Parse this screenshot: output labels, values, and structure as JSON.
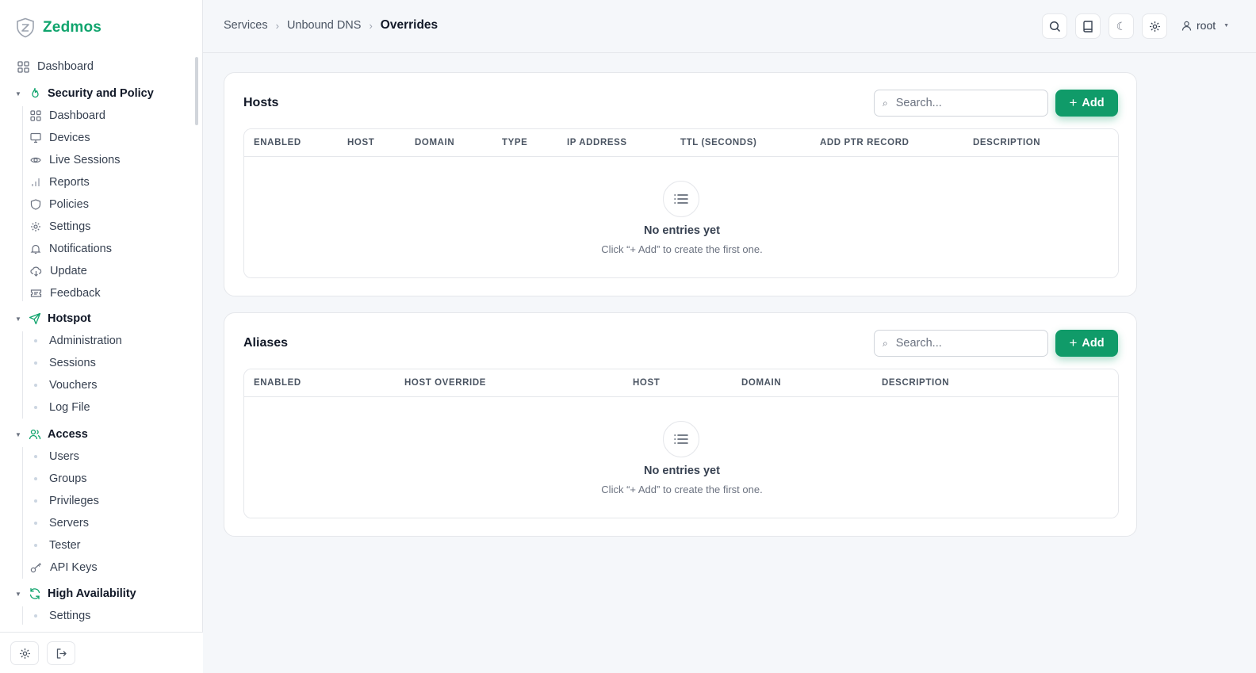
{
  "app": {
    "name": "Zedmos"
  },
  "sidebar": {
    "top_item": "Dashboard",
    "groups": [
      {
        "label": "Security and Policy",
        "items": [
          "Dashboard",
          "Devices",
          "Live Sessions",
          "Reports",
          "Policies",
          "Settings",
          "Notifications",
          "Update",
          "Feedback"
        ]
      },
      {
        "label": "Hotspot",
        "items": [
          "Administration",
          "Sessions",
          "Vouchers",
          "Log File"
        ]
      },
      {
        "label": "Access",
        "items": [
          "Users",
          "Groups",
          "Privileges",
          "Servers",
          "Tester",
          "API Keys"
        ]
      },
      {
        "label": "High Availability",
        "items": [
          "Settings"
        ]
      }
    ]
  },
  "breadcrumb": {
    "items": [
      "Services",
      "Unbound DNS"
    ],
    "current": "Overrides"
  },
  "user": {
    "name": "root"
  },
  "hosts": {
    "title": "Hosts",
    "search_placeholder": "Search...",
    "add_label": "Add",
    "columns": [
      "ENABLED",
      "HOST",
      "DOMAIN",
      "TYPE",
      "IP ADDRESS",
      "TTL (SECONDS)",
      "ADD PTR RECORD",
      "DESCRIPTION"
    ],
    "empty_title": "No entries yet",
    "empty_sub": "Click “+ Add” to create the first one."
  },
  "aliases": {
    "title": "Aliases",
    "search_placeholder": "Search...",
    "add_label": "Add",
    "columns": [
      "ENABLED",
      "HOST OVERRIDE",
      "HOST",
      "DOMAIN",
      "DESCRIPTION"
    ],
    "empty_title": "No entries yet",
    "empty_sub": "Click “+ Add” to create the first one."
  },
  "colors": {
    "accent": "#10a46d",
    "button": "#109b69"
  }
}
